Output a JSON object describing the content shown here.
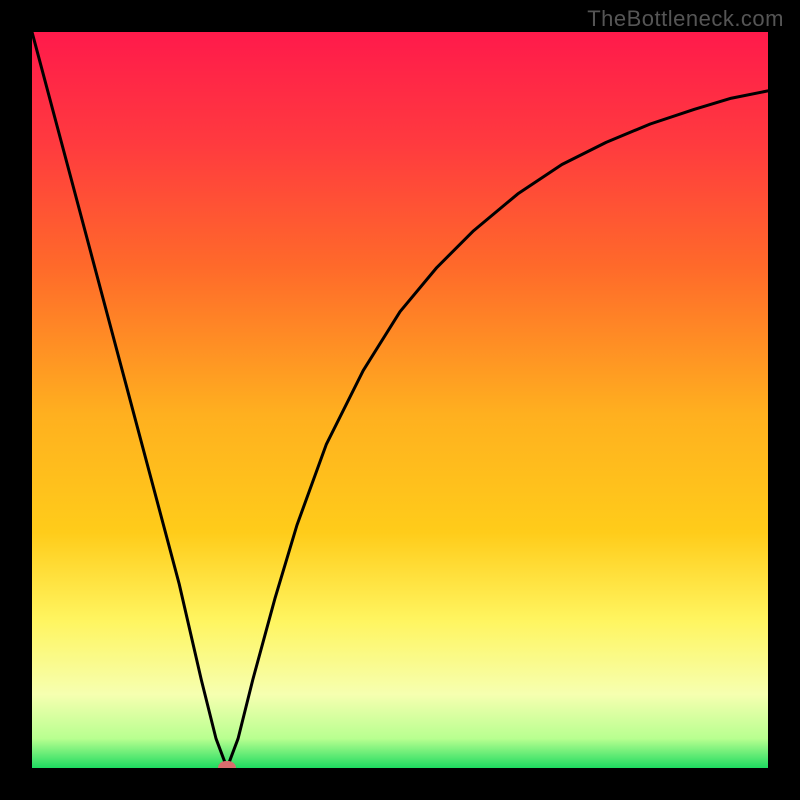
{
  "watermark": "TheBottleneck.com",
  "chart_data": {
    "type": "line",
    "title": "",
    "xlabel": "",
    "ylabel": "",
    "xlim": [
      0,
      100
    ],
    "ylim": [
      0,
      100
    ],
    "grid": false,
    "legend": false,
    "background_gradient": {
      "top": "#ff1a4b",
      "mid_upper": "#ff6a2a",
      "mid": "#ffcc1a",
      "mid_lower": "#fff560",
      "lower": "#f6ffb0",
      "bottom": "#1edb60"
    },
    "series": [
      {
        "name": "bottleneck-curve",
        "color": "#000000",
        "x": [
          0,
          4,
          8,
          12,
          16,
          20,
          23,
          25,
          26.5,
          28,
          30,
          33,
          36,
          40,
          45,
          50,
          55,
          60,
          66,
          72,
          78,
          84,
          90,
          95,
          100
        ],
        "y": [
          100,
          85,
          70,
          55,
          40,
          25,
          12,
          4,
          0,
          4,
          12,
          23,
          33,
          44,
          54,
          62,
          68,
          73,
          78,
          82,
          85,
          87.5,
          89.5,
          91,
          92
        ]
      }
    ],
    "optimum_marker": {
      "x": 26.5,
      "y": 0,
      "color": "#d96d6e"
    }
  }
}
